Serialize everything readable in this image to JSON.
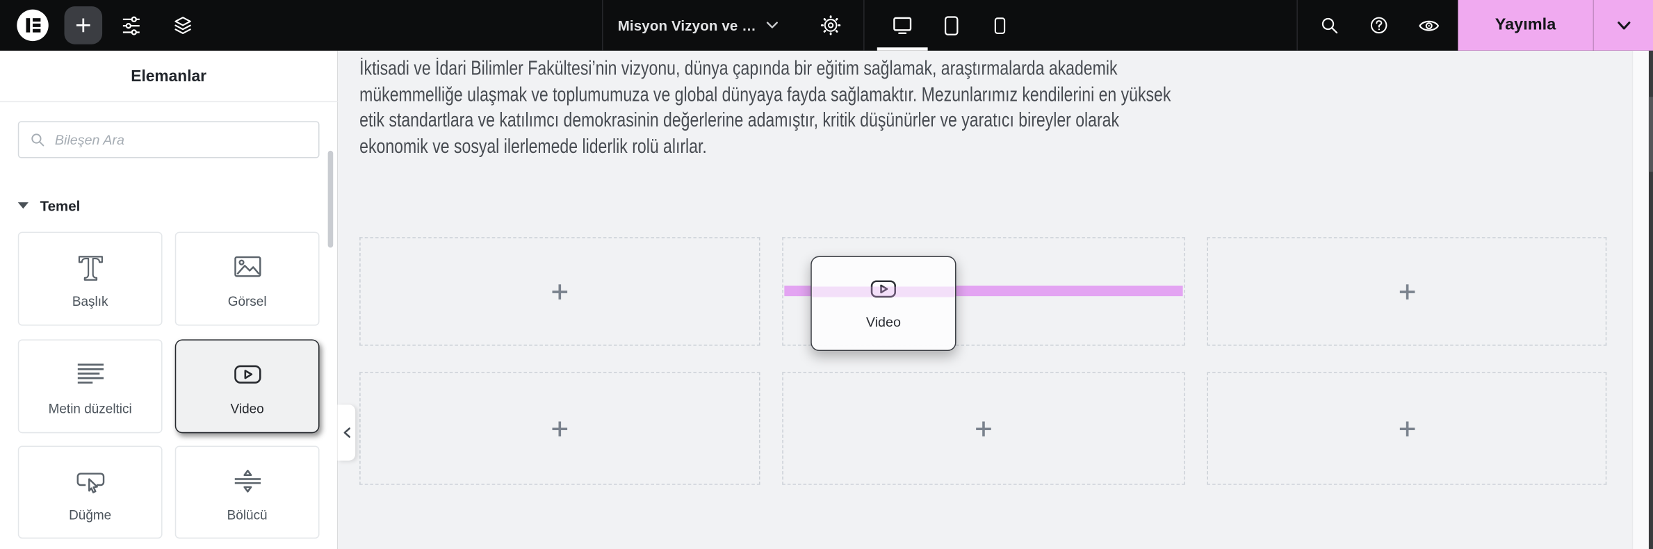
{
  "topbar": {
    "menu_icon": "elementor-logo-icon",
    "add_element_icon": "plus-icon",
    "settings_sliders_icon": "sliders-icon",
    "structure_icon": "layers-icon",
    "document": {
      "name": "Misyon Vizyon ve …",
      "chevron_icon": "chevron-down-icon",
      "settings_icon": "gear-icon"
    },
    "devices": {
      "active": "desktop",
      "items": [
        "desktop",
        "tablet",
        "mobile"
      ]
    },
    "finder_icon": "search-icon",
    "help_icon": "help-icon",
    "preview_icon": "eye-icon",
    "publish": {
      "label": "Yayımla",
      "chevron_icon": "chevron-down-icon"
    }
  },
  "panel": {
    "title": "Elemanlar",
    "search": {
      "placeholder": "Bileşen Ara",
      "icon": "search-icon"
    },
    "sections": [
      {
        "label": "Temel",
        "expanded": true
      }
    ],
    "widgets": [
      {
        "label": "Başlık",
        "icon": "heading-icon",
        "selected": false
      },
      {
        "label": "Görsel",
        "icon": "image-icon",
        "selected": false
      },
      {
        "label": "Metin düzeltici",
        "icon": "text-editor-icon",
        "selected": false
      },
      {
        "label": "Video",
        "icon": "video-icon",
        "selected": true
      },
      {
        "label": "Düğme",
        "icon": "button-icon",
        "selected": false
      },
      {
        "label": "Bölücü",
        "icon": "divider-icon",
        "selected": false
      }
    ]
  },
  "canvas": {
    "paragraph_lines": [
      "İktisadi ve İdari Bilimler Fakültesi’nin vizyonu, dünya çapında bir eğitim sağlamak, araştırmalarda akademik",
      "mükemmelliğe ulaşmak ve toplumumuza ve global dünyaya fayda sağlamaktır. Mezunlarımız kendilerini en yüksek",
      "etik standartlara ve katılımcı demokrasinin değerlerine adamıştır, kritik düşünürler ve yaratıcı bireyler olarak",
      "ekonomik ve sosyal ilerlemede liderlik rolü alırlar."
    ],
    "drop_zones": {
      "rows": 2,
      "columns": 3,
      "add_icon": "plus-icon"
    },
    "drag_ghost": {
      "label": "Video",
      "icon": "video-icon"
    },
    "insertion_indicator_color": "#e3a4f2"
  },
  "colors": {
    "topbar_bg": "#0c0d0e",
    "accent_pink": "#f0aaf0",
    "insert_line_pink": "#e3a4f2",
    "canvas_bg": "#f1f2f4",
    "panel_bg": "#ffffff",
    "icon_slate": "#5b636b"
  }
}
